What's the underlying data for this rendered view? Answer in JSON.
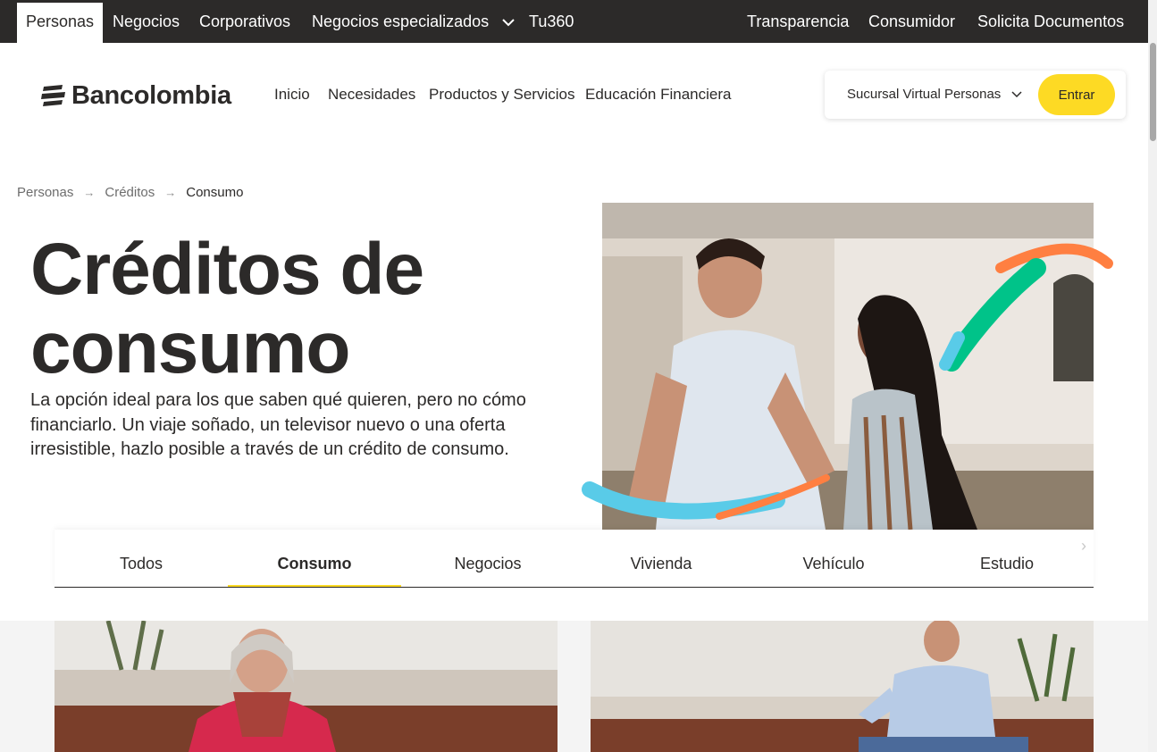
{
  "topbar": {
    "left_items": [
      "Personas",
      "Negocios",
      "Corporativos",
      "Negocios especializados",
      "Tu360"
    ],
    "right_items": [
      "Transparencia",
      "Consumidor",
      "Solicita Documentos"
    ]
  },
  "header": {
    "logo_text": "Bancolombia",
    "nav": [
      "Inicio",
      "Necesidades",
      "Productos y Servicios",
      "Educación Financiera"
    ],
    "login_select": "Sucursal Virtual Personas",
    "login_button": "Entrar"
  },
  "breadcrumb": [
    "Personas",
    "Créditos",
    "Consumo"
  ],
  "hero": {
    "title_line1": "Créditos de",
    "title_line2": "consumo",
    "description": "La opción ideal para los que saben qué quieren, pero no cómo financiarlo. Un viaje soñado, un televisor nuevo o una oferta irresistible, hazlo posible a través de un crédito de consumo."
  },
  "tabs": [
    "Todos",
    "Consumo",
    "Negocios",
    "Vivienda",
    "Vehículo",
    "Estudio"
  ],
  "active_tab": "Consumo",
  "colors": {
    "brand_yellow": "#fdda24",
    "dark": "#2c2a29",
    "accent_green": "#00c389",
    "accent_orange": "#ff7f41",
    "accent_blue": "#59cbe8"
  }
}
